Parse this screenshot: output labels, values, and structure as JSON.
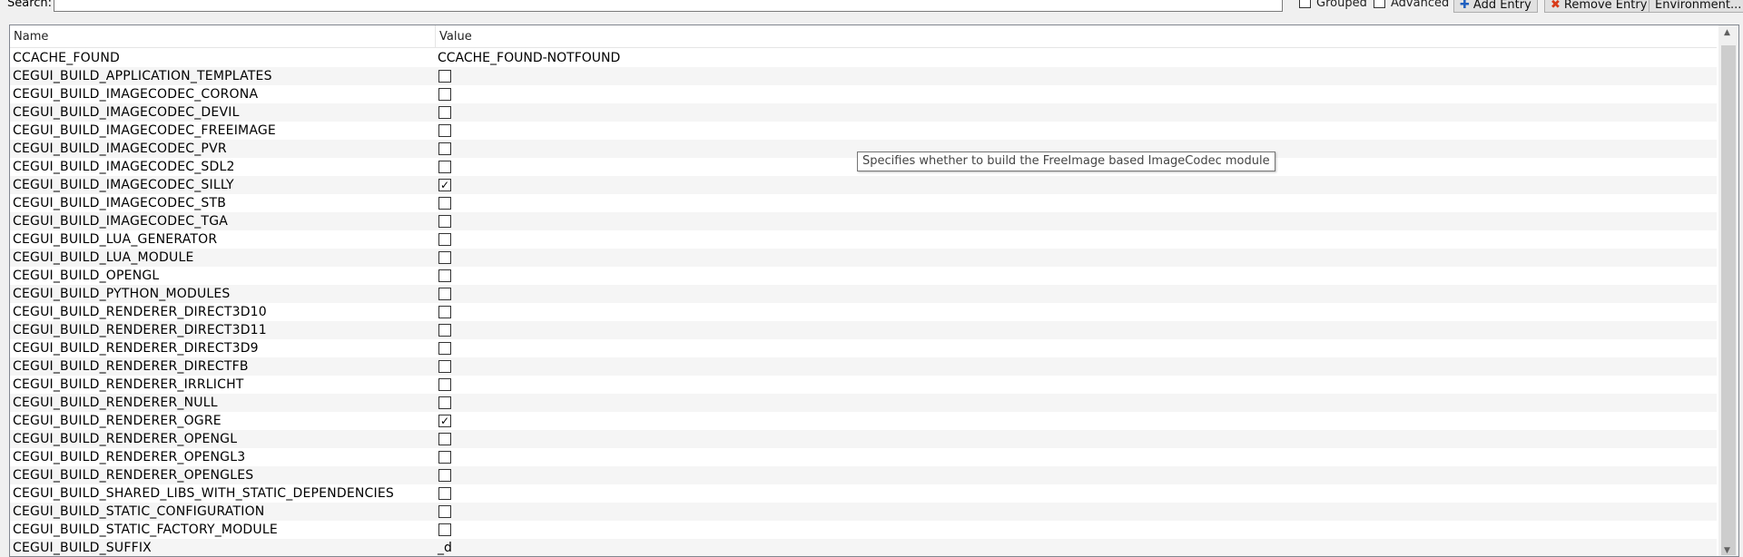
{
  "toolbar": {
    "search_label": "Search:",
    "search_value": "",
    "grouped_label": "Grouped",
    "advanced_label": "Advanced",
    "add_entry_label": "Add Entry",
    "remove_entry_label": "Remove Entry",
    "environment_label": "Environment..."
  },
  "table": {
    "columns": [
      "Name",
      "Value"
    ],
    "rows": [
      {
        "name": "CCACHE_FOUND",
        "type": "text",
        "value": "CCACHE_FOUND-NOTFOUND"
      },
      {
        "name": "CEGUI_BUILD_APPLICATION_TEMPLATES",
        "type": "bool",
        "checked": false
      },
      {
        "name": "CEGUI_BUILD_IMAGECODEC_CORONA",
        "type": "bool",
        "checked": false
      },
      {
        "name": "CEGUI_BUILD_IMAGECODEC_DEVIL",
        "type": "bool",
        "checked": false
      },
      {
        "name": "CEGUI_BUILD_IMAGECODEC_FREEIMAGE",
        "type": "bool",
        "checked": false
      },
      {
        "name": "CEGUI_BUILD_IMAGECODEC_PVR",
        "type": "bool",
        "checked": false
      },
      {
        "name": "CEGUI_BUILD_IMAGECODEC_SDL2",
        "type": "bool",
        "checked": false
      },
      {
        "name": "CEGUI_BUILD_IMAGECODEC_SILLY",
        "type": "bool",
        "checked": true
      },
      {
        "name": "CEGUI_BUILD_IMAGECODEC_STB",
        "type": "bool",
        "checked": false
      },
      {
        "name": "CEGUI_BUILD_IMAGECODEC_TGA",
        "type": "bool",
        "checked": false
      },
      {
        "name": "CEGUI_BUILD_LUA_GENERATOR",
        "type": "bool",
        "checked": false
      },
      {
        "name": "CEGUI_BUILD_LUA_MODULE",
        "type": "bool",
        "checked": false
      },
      {
        "name": "CEGUI_BUILD_OPENGL",
        "type": "bool",
        "checked": false
      },
      {
        "name": "CEGUI_BUILD_PYTHON_MODULES",
        "type": "bool",
        "checked": false
      },
      {
        "name": "CEGUI_BUILD_RENDERER_DIRECT3D10",
        "type": "bool",
        "checked": false
      },
      {
        "name": "CEGUI_BUILD_RENDERER_DIRECT3D11",
        "type": "bool",
        "checked": false
      },
      {
        "name": "CEGUI_BUILD_RENDERER_DIRECT3D9",
        "type": "bool",
        "checked": false
      },
      {
        "name": "CEGUI_BUILD_RENDERER_DIRECTFB",
        "type": "bool",
        "checked": false
      },
      {
        "name": "CEGUI_BUILD_RENDERER_IRRLICHT",
        "type": "bool",
        "checked": false
      },
      {
        "name": "CEGUI_BUILD_RENDERER_NULL",
        "type": "bool",
        "checked": false
      },
      {
        "name": "CEGUI_BUILD_RENDERER_OGRE",
        "type": "bool",
        "checked": true
      },
      {
        "name": "CEGUI_BUILD_RENDERER_OPENGL",
        "type": "bool",
        "checked": false
      },
      {
        "name": "CEGUI_BUILD_RENDERER_OPENGL3",
        "type": "bool",
        "checked": false
      },
      {
        "name": "CEGUI_BUILD_RENDERER_OPENGLES",
        "type": "bool",
        "checked": false
      },
      {
        "name": "CEGUI_BUILD_SHARED_LIBS_WITH_STATIC_DEPENDENCIES",
        "type": "bool",
        "checked": false
      },
      {
        "name": "CEGUI_BUILD_STATIC_CONFIGURATION",
        "type": "bool",
        "checked": false
      },
      {
        "name": "CEGUI_BUILD_STATIC_FACTORY_MODULE",
        "type": "bool",
        "checked": false
      },
      {
        "name": "CEGUI_BUILD_SUFFIX",
        "type": "text",
        "value": "_d"
      }
    ]
  },
  "tooltip": {
    "text": "Specifies whether to build the FreeImage based ImageCodec module"
  },
  "scrollbar": {
    "up_icon": "triangle-up",
    "down_icon": "triangle-down"
  }
}
